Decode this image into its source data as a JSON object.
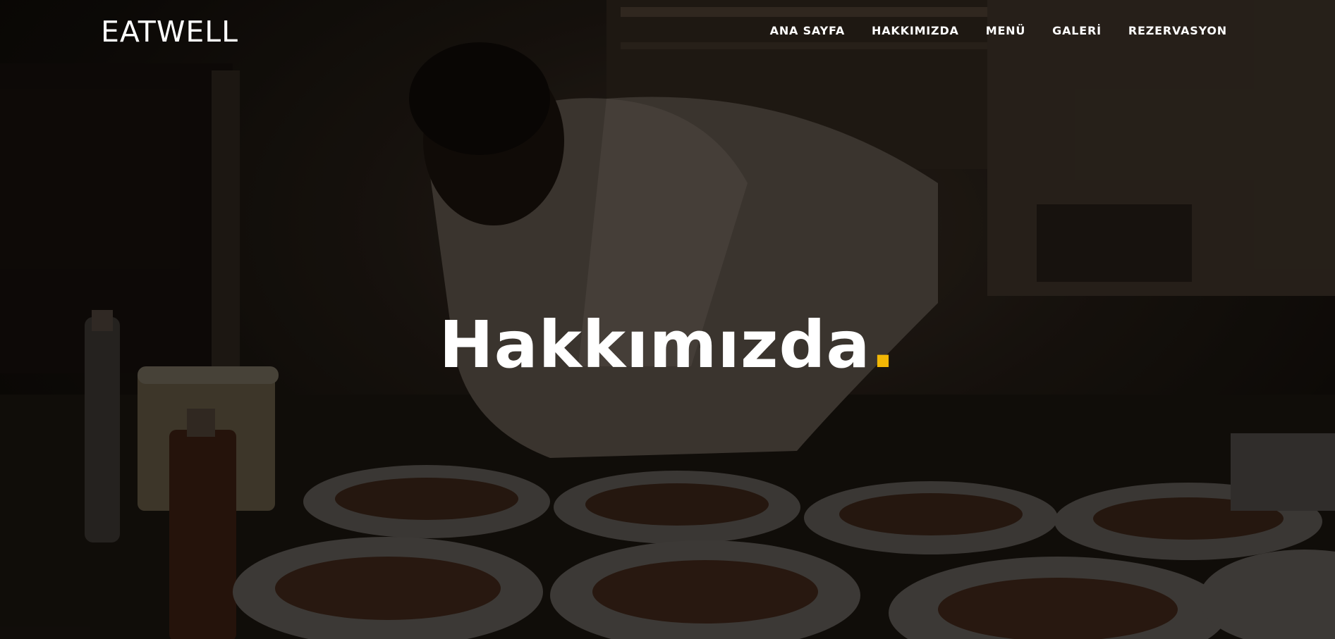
{
  "brand": {
    "logo": "EATWELL"
  },
  "nav": {
    "items": [
      {
        "label": "ANA SAYFA"
      },
      {
        "label": "HAKKIMIZDA"
      },
      {
        "label": "MENÜ"
      },
      {
        "label": "GALERİ"
      },
      {
        "label": "REZERVASYON"
      }
    ]
  },
  "hero": {
    "title": "Hakkımızda",
    "title_dot": ".",
    "accent_color": "#f2b705"
  }
}
